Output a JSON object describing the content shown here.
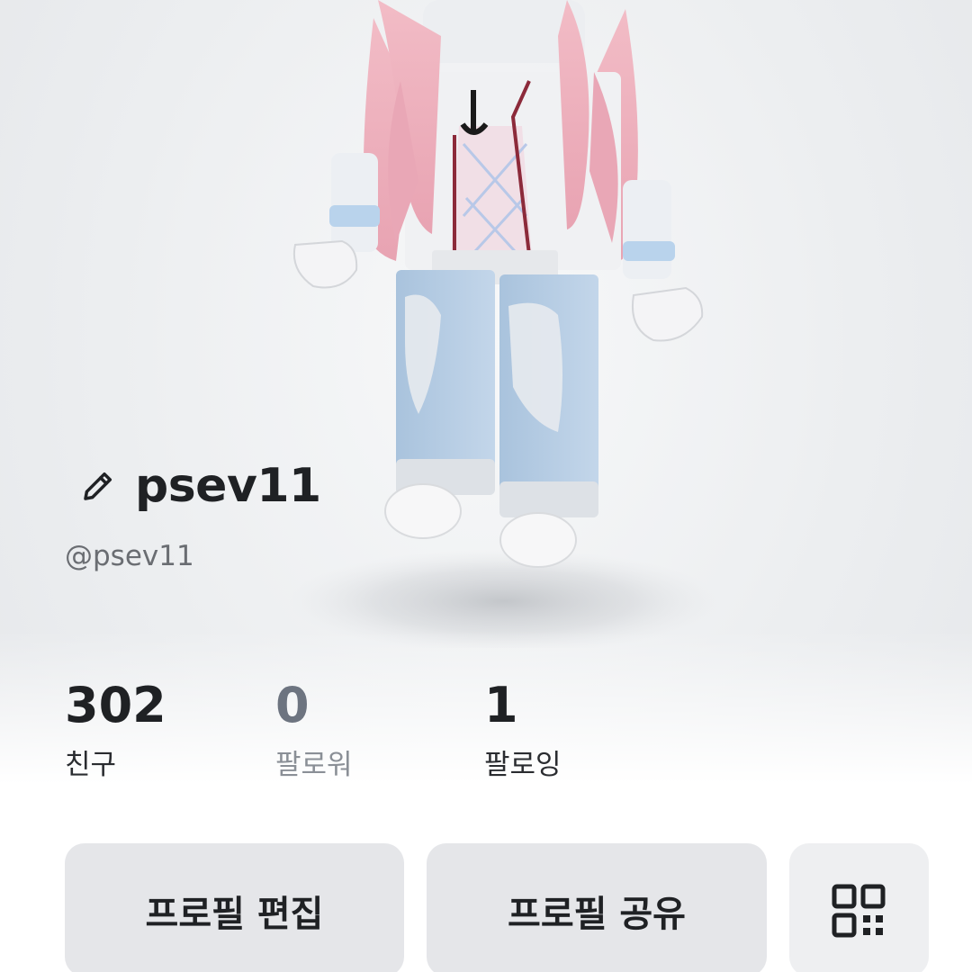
{
  "profile": {
    "display_name": "psev11",
    "handle": "@psev11",
    "edit_icon": "pencil-icon"
  },
  "stats": {
    "friends": {
      "count": "302",
      "label": "친구"
    },
    "followers": {
      "count": "0",
      "label": "팔로워"
    },
    "following": {
      "count": "1",
      "label": "팔로잉"
    }
  },
  "actions": {
    "edit_profile": "프로필 편집",
    "share_profile": "프로필 공유",
    "qr_icon": "qr-code-icon"
  }
}
